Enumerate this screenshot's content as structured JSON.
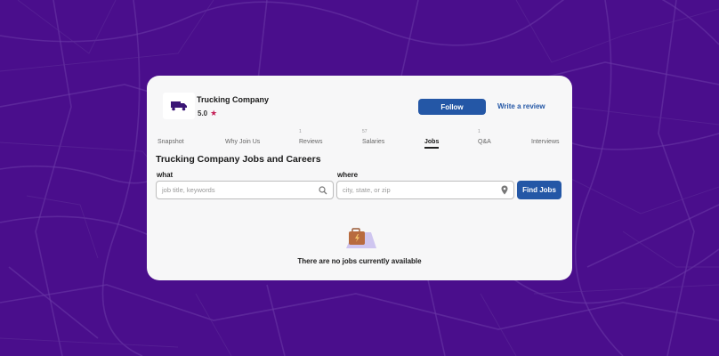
{
  "colors": {
    "background": "#4a0e8c",
    "accent": "#2457a6",
    "star": "#c41f56"
  },
  "company": {
    "name": "Trucking Company",
    "rating": "5.0",
    "logo_icon": "truck-icon"
  },
  "actions": {
    "follow_label": "Follow",
    "review_label": "Write a review"
  },
  "tabs": [
    {
      "label": "Snapshot",
      "count": ""
    },
    {
      "label": "Why Join Us",
      "count": ""
    },
    {
      "label": "Reviews",
      "count": "1"
    },
    {
      "label": "Salaries",
      "count": "57"
    },
    {
      "label": "Jobs",
      "count": ""
    },
    {
      "label": "Q&A",
      "count": "1"
    },
    {
      "label": "Interviews",
      "count": ""
    }
  ],
  "active_tab": "Jobs",
  "page_title": "Trucking Company Jobs and Careers",
  "search": {
    "what_label": "what",
    "what_placeholder": "job title, keywords",
    "where_label": "where",
    "where_placeholder": "city, state, or zip",
    "button_label": "Find Jobs"
  },
  "empty_state": {
    "icon": "briefcase-icon",
    "message": "There are no jobs currently available"
  }
}
